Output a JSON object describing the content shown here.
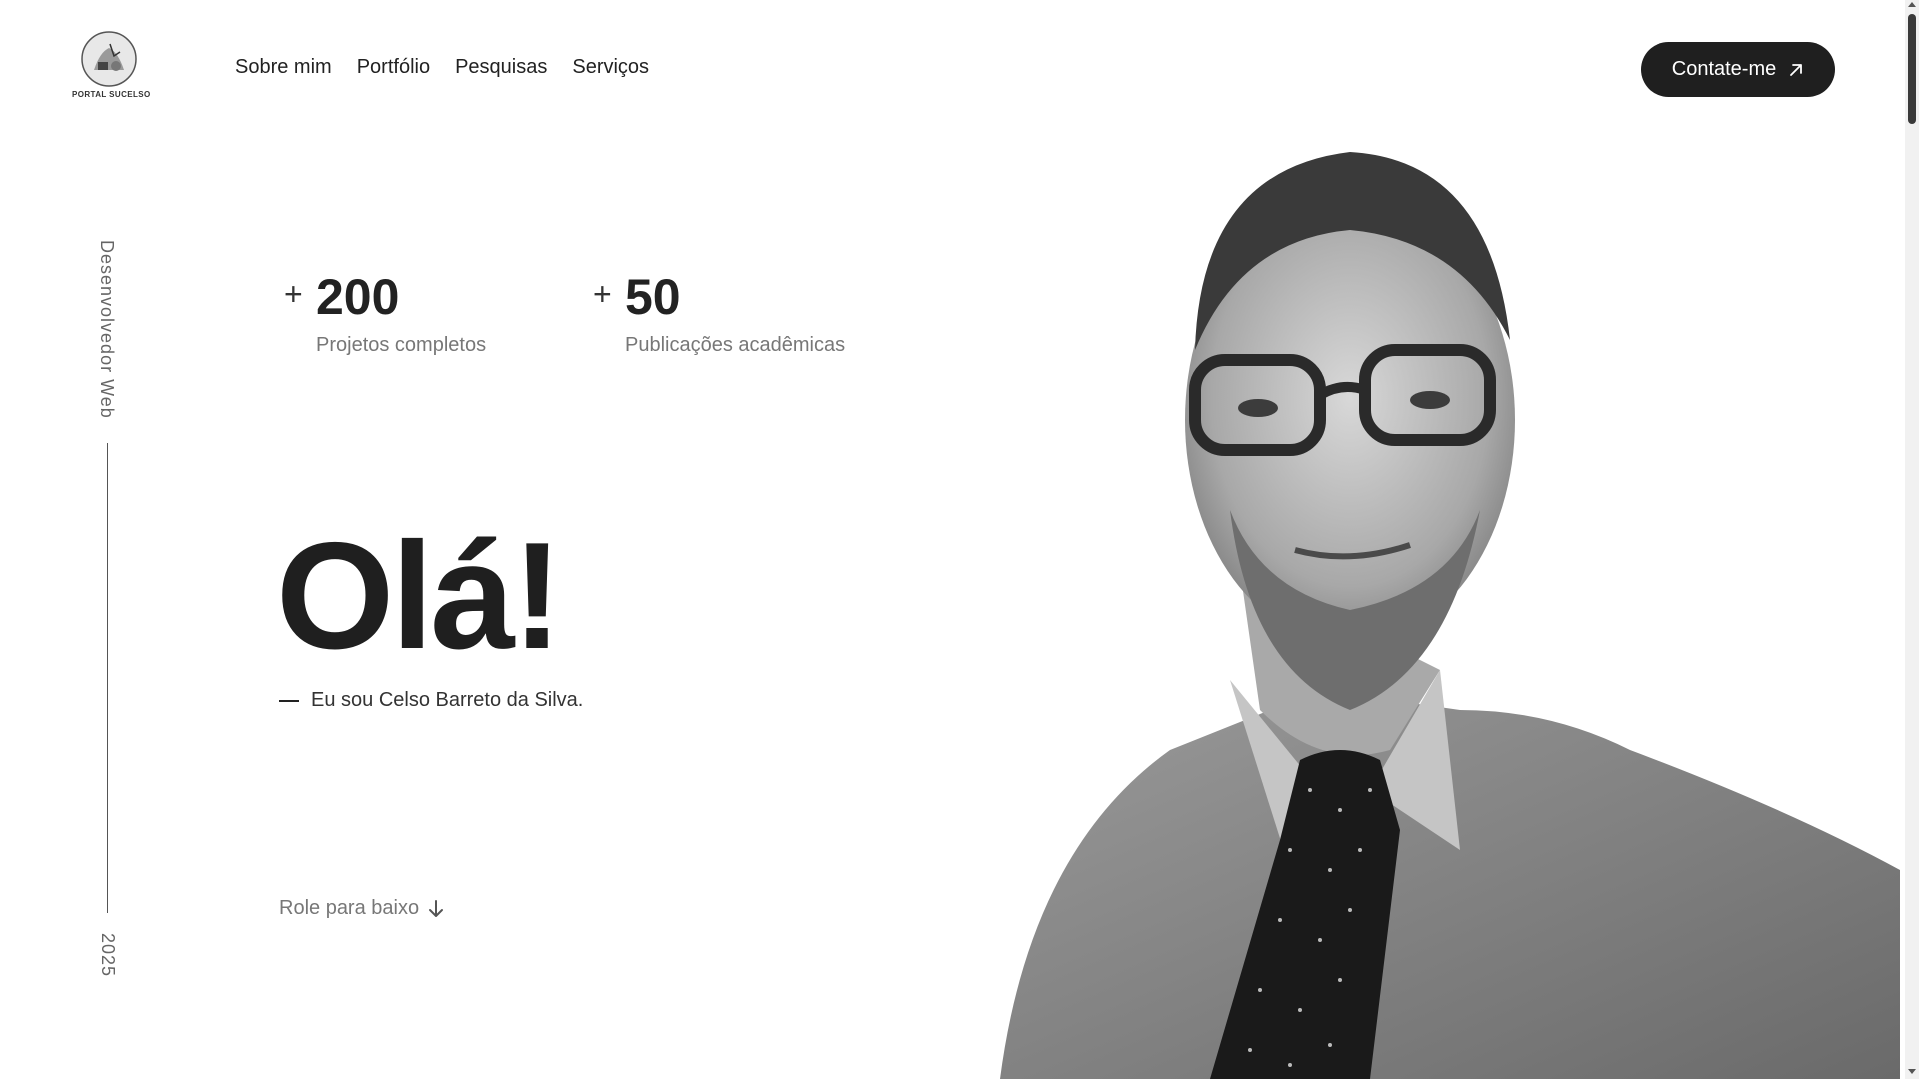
{
  "brand": {
    "logo_text": "PORTAL SUCELSO"
  },
  "nav": {
    "items": [
      {
        "label": "Sobre mim"
      },
      {
        "label": "Portfólio"
      },
      {
        "label": "Pesquisas"
      },
      {
        "label": "Serviços"
      }
    ]
  },
  "cta": {
    "label": "Contate-me",
    "icon": "arrow-up-right-icon"
  },
  "side": {
    "role": "Desenvolvedor Web",
    "year": "2025"
  },
  "stats": [
    {
      "prefix": "+",
      "value": "200",
      "label": "Projetos completos"
    },
    {
      "prefix": "+",
      "value": "50",
      "label": "Publicações acadêmicas"
    }
  ],
  "hero": {
    "title": "Olá!",
    "subtitle": "Eu sou Celso Barreto da Silva."
  },
  "scroll_hint": {
    "label": "Role para baixo",
    "icon": "arrow-down-icon"
  },
  "colors": {
    "primary": "#1f1f1f",
    "muted": "#777777",
    "background": "#ffffff"
  }
}
